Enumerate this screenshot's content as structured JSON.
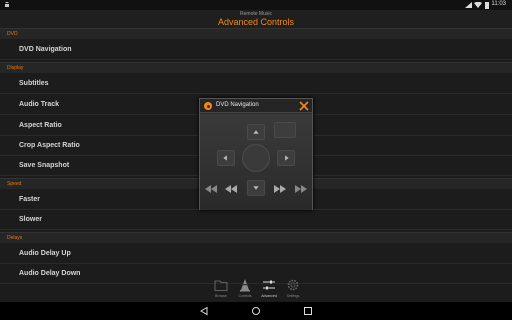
{
  "status": {
    "time": "11:03"
  },
  "header": {
    "app_name": "Remote Music",
    "title": "Advanced Controls"
  },
  "sections": [
    {
      "label": "DVD",
      "items": [
        "DVD Navigation"
      ]
    },
    {
      "label": "Display",
      "items": [
        "Subtitles",
        "Audio Track",
        "Aspect Ratio",
        "Crop Aspect Ratio",
        "Save Snapshot"
      ]
    },
    {
      "label": "Speed",
      "items": [
        "Faster",
        "Slower"
      ]
    },
    {
      "label": "Delays",
      "items": [
        "Audio Delay Up",
        "Audio Delay Down"
      ]
    }
  ],
  "dialog": {
    "title": "DVD Navigation"
  },
  "tabs": [
    {
      "label": "Browse",
      "icon": "folder-icon"
    },
    {
      "label": "Controls",
      "icon": "vlc-cone-icon"
    },
    {
      "label": "Advanced",
      "icon": "sliders-icon",
      "active": true
    },
    {
      "label": "Settings",
      "icon": "gear-icon"
    }
  ],
  "colors": {
    "accent": "#f08a1c",
    "background": "#1c1c1c"
  }
}
